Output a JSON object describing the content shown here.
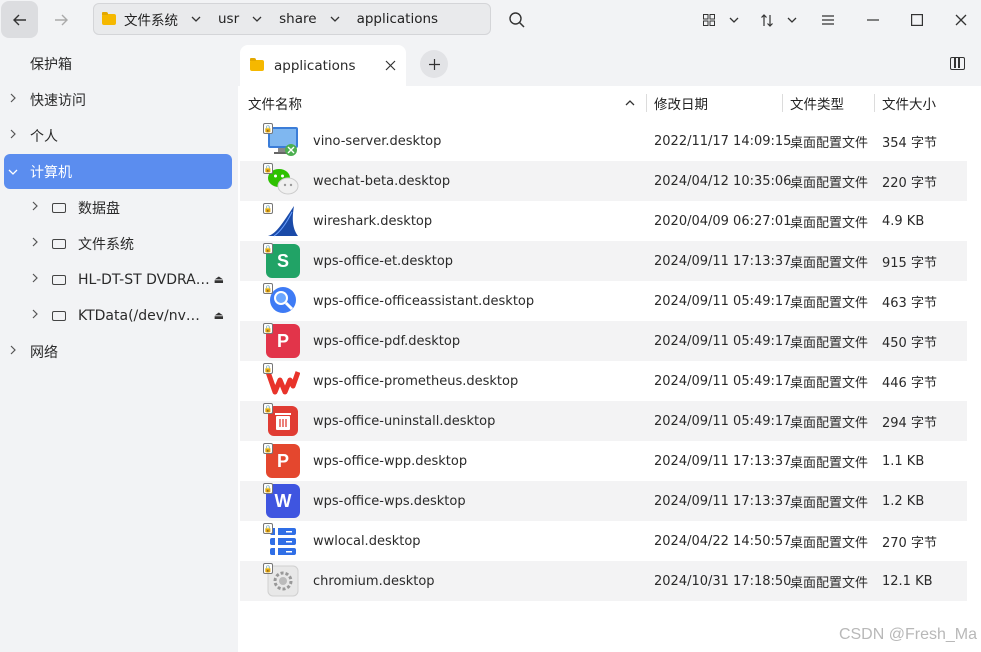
{
  "toolbar": {
    "breadcrumbs": [
      "文件系统",
      "usr",
      "share",
      "applications"
    ]
  },
  "sidebar": {
    "items": [
      {
        "label": "保护箱"
      },
      {
        "label": "快速访问"
      },
      {
        "label": "个人"
      },
      {
        "label": "计算机"
      },
      {
        "label": "数据盘"
      },
      {
        "label": "文件系统"
      },
      {
        "label": "HL-DT-ST DVDRA…"
      },
      {
        "label": "KTData(/dev/nv…"
      },
      {
        "label": "网络"
      }
    ]
  },
  "tab": {
    "label": "applications"
  },
  "columns": {
    "name": "文件名称",
    "date": "修改日期",
    "type": "文件类型",
    "size": "文件大小"
  },
  "files": [
    {
      "name": "vino-server.desktop",
      "date": "2022/11/17 14:09:15",
      "type": "桌面配置文件",
      "size": "354 字节",
      "icon": "vino-server-icon"
    },
    {
      "name": "wechat-beta.desktop",
      "date": "2024/04/12 10:35:06",
      "type": "桌面配置文件",
      "size": "220 字节",
      "icon": "wechat-icon"
    },
    {
      "name": "wireshark.desktop",
      "date": "2020/04/09 06:27:01",
      "type": "桌面配置文件",
      "size": "4.9 KB",
      "icon": "wireshark-icon"
    },
    {
      "name": "wps-office-et.desktop",
      "date": "2024/09/11 17:13:37",
      "type": "桌面配置文件",
      "size": "915 字节",
      "icon": "wps-et-icon"
    },
    {
      "name": "wps-office-officeassistant.desktop",
      "date": "2024/09/11 05:49:17",
      "type": "桌面配置文件",
      "size": "463 字节",
      "icon": "wps-assistant-icon"
    },
    {
      "name": "wps-office-pdf.desktop",
      "date": "2024/09/11 05:49:17",
      "type": "桌面配置文件",
      "size": "450 字节",
      "icon": "wps-pdf-icon"
    },
    {
      "name": "wps-office-prometheus.desktop",
      "date": "2024/09/11 05:49:17",
      "type": "桌面配置文件",
      "size": "446 字节",
      "icon": "wps-prometheus-icon"
    },
    {
      "name": "wps-office-uninstall.desktop",
      "date": "2024/09/11 05:49:17",
      "type": "桌面配置文件",
      "size": "294 字节",
      "icon": "wps-uninstall-icon"
    },
    {
      "name": "wps-office-wpp.desktop",
      "date": "2024/09/11 17:13:37",
      "type": "桌面配置文件",
      "size": "1.1 KB",
      "icon": "wps-wpp-icon"
    },
    {
      "name": "wps-office-wps.desktop",
      "date": "2024/09/11 17:13:37",
      "type": "桌面配置文件",
      "size": "1.2 KB",
      "icon": "wps-writer-icon"
    },
    {
      "name": "wwlocal.desktop",
      "date": "2024/04/22 14:50:57",
      "type": "桌面配置文件",
      "size": "270 字节",
      "icon": "wwlocal-icon"
    },
    {
      "name": "chromium.desktop",
      "date": "2024/10/31 17:18:50",
      "type": "桌面配置文件",
      "size": "12.1 KB",
      "icon": "chromium-icon"
    }
  ],
  "watermark": "CSDN @Fresh_Ma",
  "colors": {
    "accent": "#5b8def",
    "sidebar_bg": "#f2f3f5",
    "row_alt": "#f3f3f4"
  }
}
